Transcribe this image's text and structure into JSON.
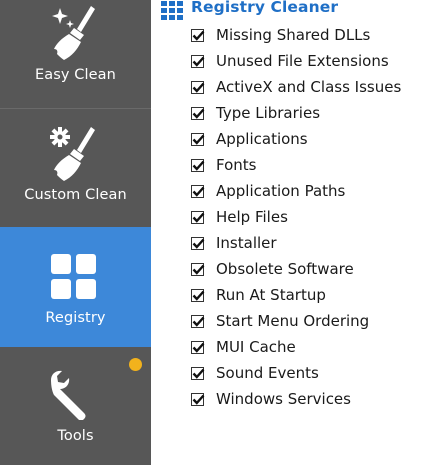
{
  "sidebar": {
    "items": [
      {
        "label": "Easy Clean",
        "icon": "broom-sparkle-icon"
      },
      {
        "label": "Custom Clean",
        "icon": "broom-gear-icon"
      },
      {
        "label": "Registry",
        "icon": "registry-grid-icon"
      },
      {
        "label": "Tools",
        "icon": "wrench-icon"
      }
    ],
    "selected": "Registry",
    "colors": {
      "sidebar_bg": "#575757",
      "selected_bg": "#3d88d9",
      "badge": "#f2b21c"
    }
  },
  "registry": {
    "title": "Registry Cleaner",
    "title_color": "#1f6fc6",
    "items": [
      {
        "label": "Missing Shared DLLs",
        "checked": true
      },
      {
        "label": "Unused File Extensions",
        "checked": true
      },
      {
        "label": "ActiveX and Class Issues",
        "checked": true
      },
      {
        "label": "Type Libraries",
        "checked": true
      },
      {
        "label": "Applications",
        "checked": true
      },
      {
        "label": "Fonts",
        "checked": true
      },
      {
        "label": "Application Paths",
        "checked": true
      },
      {
        "label": "Help Files",
        "checked": true
      },
      {
        "label": "Installer",
        "checked": true
      },
      {
        "label": "Obsolete Software",
        "checked": true
      },
      {
        "label": "Run At Startup",
        "checked": true
      },
      {
        "label": "Start Menu Ordering",
        "checked": true
      },
      {
        "label": "MUI Cache",
        "checked": true
      },
      {
        "label": "Sound Events",
        "checked": true
      },
      {
        "label": "Windows Services",
        "checked": true
      }
    ]
  }
}
